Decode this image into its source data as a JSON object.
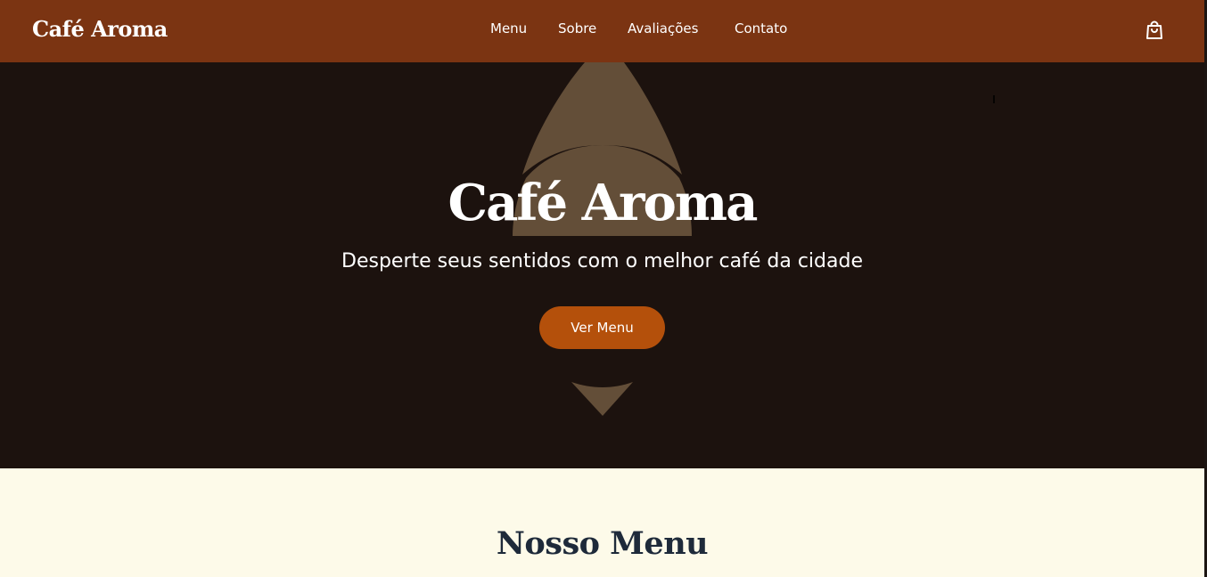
{
  "header": {
    "logo": "Café Aroma",
    "nav": [
      {
        "label": "Menu"
      },
      {
        "label": "Sobre"
      },
      {
        "label": "Avaliações"
      },
      {
        "label": "Contato"
      }
    ],
    "cart_icon": "shopping-bag-icon"
  },
  "hero": {
    "title": "Café Aroma",
    "subtitle": "Desperte seus sentidos com o melhor café da cidade",
    "cta_label": "Ver Menu",
    "decoration_icon": "coffee-bean-shape"
  },
  "menu_section": {
    "title": "Nosso Menu"
  },
  "colors": {
    "navbar": "#7b3412",
    "hero_background": "#1c120e",
    "hero_decoration": "#634e38",
    "button": "#b4500b",
    "section_background": "#fdfae9",
    "section_title": "#1e2a3a"
  }
}
